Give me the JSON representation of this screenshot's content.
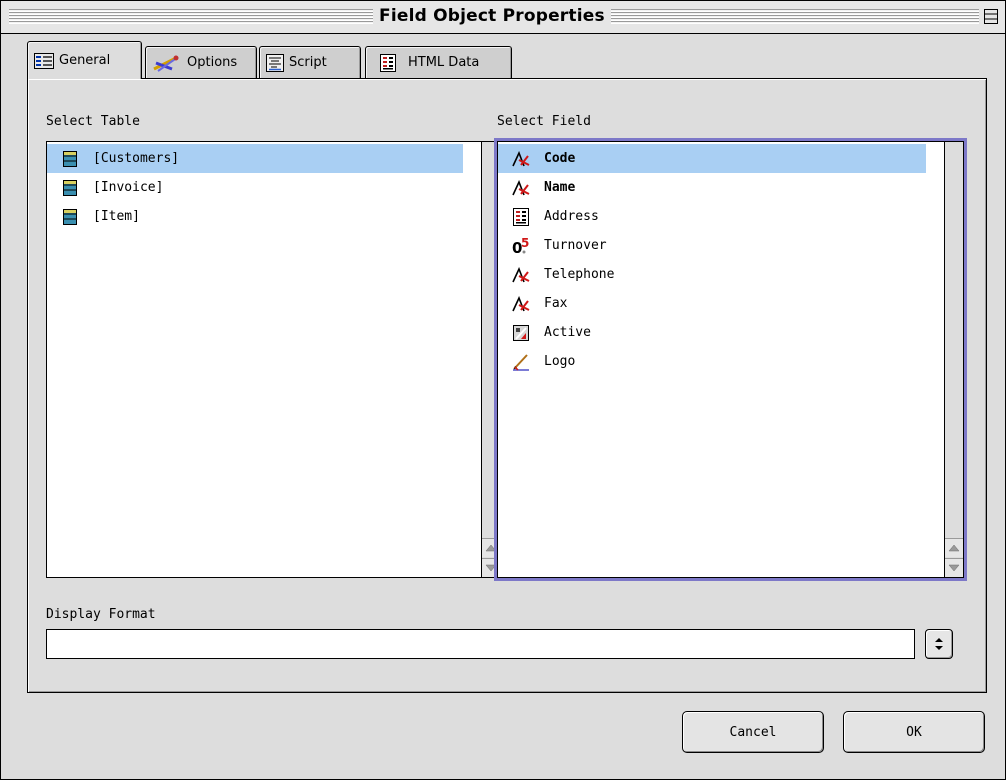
{
  "window": {
    "title": "Field Object Properties"
  },
  "tabs": [
    {
      "label": "General",
      "icon": "general-icon",
      "active": true
    },
    {
      "label": "Options",
      "icon": "options-icon",
      "active": false
    },
    {
      "label": "Script",
      "icon": "script-icon",
      "active": false
    },
    {
      "label": "HTML Data",
      "icon": "html-data-icon",
      "active": false
    }
  ],
  "table_list": {
    "label": "Select Table",
    "items": [
      {
        "label": "[Customers]",
        "icon": "table-icon",
        "selected": true
      },
      {
        "label": "[Invoice]",
        "icon": "table-icon",
        "selected": false
      },
      {
        "label": "[Item]",
        "icon": "table-icon",
        "selected": false
      }
    ]
  },
  "field_list": {
    "label": "Select Field",
    "items": [
      {
        "label": "Code",
        "icon": "alpha-field-icon",
        "bold": true,
        "selected": true
      },
      {
        "label": "Name",
        "icon": "alpha-field-icon",
        "bold": true,
        "selected": false
      },
      {
        "label": "Address",
        "icon": "text-field-icon",
        "bold": false,
        "selected": false
      },
      {
        "label": "Turnover",
        "icon": "real-field-icon",
        "bold": false,
        "selected": false
      },
      {
        "label": "Telephone",
        "icon": "alpha-field-icon",
        "bold": false,
        "selected": false
      },
      {
        "label": "Fax",
        "icon": "alpha-field-icon",
        "bold": false,
        "selected": false
      },
      {
        "label": "Active",
        "icon": "boolean-field-icon",
        "bold": false,
        "selected": false
      },
      {
        "label": "Logo",
        "icon": "picture-field-icon",
        "bold": false,
        "selected": false
      }
    ]
  },
  "display_format": {
    "label": "Display Format",
    "value": ""
  },
  "buttons": {
    "cancel": "Cancel",
    "ok": "OK"
  },
  "colors": {
    "selection": "#a9cff3",
    "focus_ring": "#7d78c8",
    "window_bg": "#dddddd"
  }
}
